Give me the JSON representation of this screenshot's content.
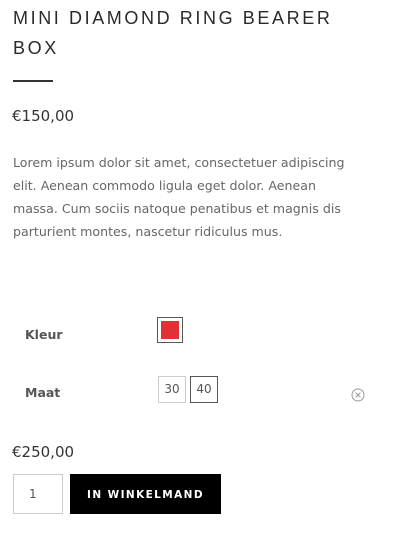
{
  "product": {
    "title": "MINI DIAMOND RING BEARER BOX",
    "price": "€150,00",
    "description": "Lorem ipsum dolor sit amet, consectetuer adipiscing elit. Aenean commodo ligula eget dolor. Aenean massa. Cum sociis natoque penatibus et magnis dis parturient montes, nascetur ridiculus mus."
  },
  "variations": {
    "color": {
      "label": "Kleur",
      "swatch_color": "#e03232"
    },
    "size": {
      "label": "Maat",
      "options": [
        "30",
        "40"
      ],
      "selected": "40"
    },
    "reset_icon": "circle-x-icon"
  },
  "purchase": {
    "variation_price": "€250,00",
    "quantity": "1",
    "add_to_cart_label": "IN WINKELMAND",
    "button_color": "#000000"
  }
}
